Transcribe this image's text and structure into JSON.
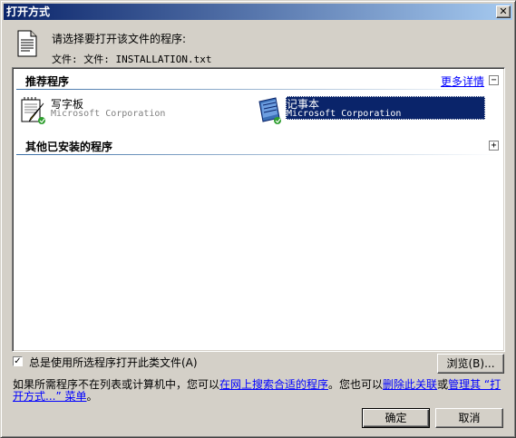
{
  "window": {
    "title": "打开方式",
    "close_glyph": "✕"
  },
  "header": {
    "prompt": "请选择要打开该文件的程序:",
    "file_label": "文件:  文件: INSTALLATION.txt"
  },
  "recommended": {
    "title": "推荐程序",
    "more_link": "更多详情",
    "toggle": "−",
    "programs": [
      {
        "name": "写字板",
        "company": "Microsoft Corporation",
        "icon": "wordpad-icon"
      },
      {
        "name": "记事本",
        "company": "Microsoft Corporation",
        "icon": "notepad-icon",
        "selected": true
      }
    ]
  },
  "other": {
    "title": "其他已安装的程序",
    "toggle": "+"
  },
  "always_use": {
    "checked": true,
    "check_glyph": "✓",
    "label": "总是使用所选程序打开此类文件(A)"
  },
  "buttons": {
    "browse": "浏览(B)...",
    "ok": "确定",
    "cancel": "取消"
  },
  "info": {
    "text1": "如果所需程序不在列表或计算机中，您可以",
    "link1": "在网上搜索合适的程序",
    "text2": "。您也可以",
    "link2": "删除此关联",
    "text3": "或",
    "link3": "管理其 “打开方式...” 菜单",
    "text4": "。"
  },
  "colors": {
    "title_bar_start": "#0a246a",
    "title_bar_end": "#a6caf0",
    "selection": "#0a246a",
    "link": "#0000ff",
    "face": "#d4d0c8"
  }
}
